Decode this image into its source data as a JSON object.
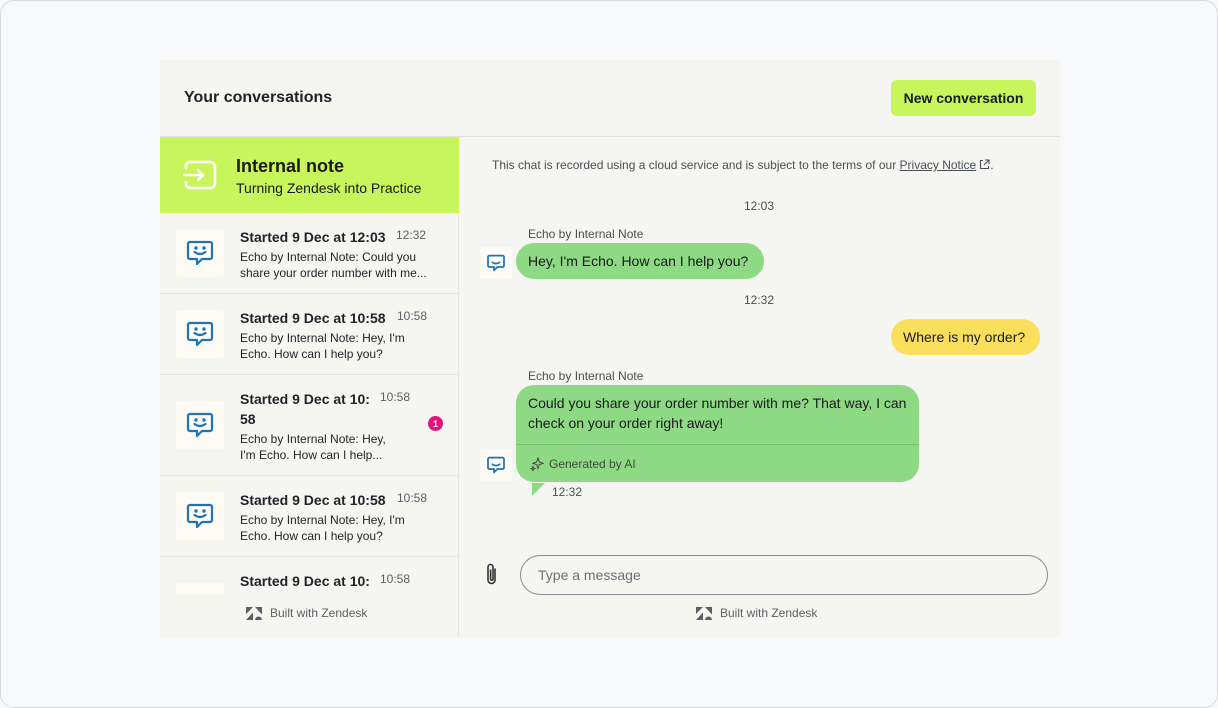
{
  "header": {
    "title": "Your conversations",
    "new_button": "New conversation"
  },
  "brand": {
    "name": "Internal note",
    "subtitle": "Turning Zendesk into Practice",
    "icon": "sign-in-arrow-icon"
  },
  "conversations": [
    {
      "title": "Started 9 Dec at 12:03",
      "time": "12:32",
      "preview_1": "Echo by Internal Note: Could you",
      "preview_2": "share your order number with me..."
    },
    {
      "title": "Started 9 Dec at 10:58",
      "time": "10:58",
      "preview_1": "Echo by Internal Note: Hey, I'm",
      "preview_2": "Echo. How can I help you?"
    },
    {
      "title_1": "Started 9 Dec at 10:",
      "title_2": "58",
      "time": "10:58",
      "preview_1": "Echo by Internal Note: Hey,",
      "preview_2": "I'm Echo. How can I help...",
      "unread": "1"
    },
    {
      "title": "Started 9 Dec at 10:58",
      "time": "10:58",
      "preview_1": "Echo by Internal Note: Hey, I'm",
      "preview_2": "Echo. How can I help you?"
    },
    {
      "title": "Started 9 Dec at 10:",
      "time": "10:58"
    }
  ],
  "footer": {
    "built_with": "Built with Zendesk"
  },
  "chat": {
    "notice_text": "This chat is recorded using a cloud service and is subject to the terms of our ",
    "notice_link": "Privacy Notice",
    "notice_end": ".",
    "messages": [
      {
        "timestamp": "12:03"
      },
      {
        "sender": "Echo by Internal Note",
        "text": "Hey, I'm Echo. How can I help you?"
      },
      {
        "timestamp": "12:32"
      },
      {
        "text": "Where is my order?"
      },
      {
        "sender": "Echo by Internal Note",
        "text": "Could you share your order number with me? That way, I can check on your order right away!",
        "tag": "Generated by AI",
        "time": "12:32"
      }
    ],
    "composer_placeholder": "Type a message"
  },
  "colors": {
    "brand": "#c8f55b",
    "bot_bubble": "#8ed984",
    "user_bubble": "#fadf5c",
    "unread_badge": "#e0157b",
    "avatar_icon": "#1f73b7"
  }
}
